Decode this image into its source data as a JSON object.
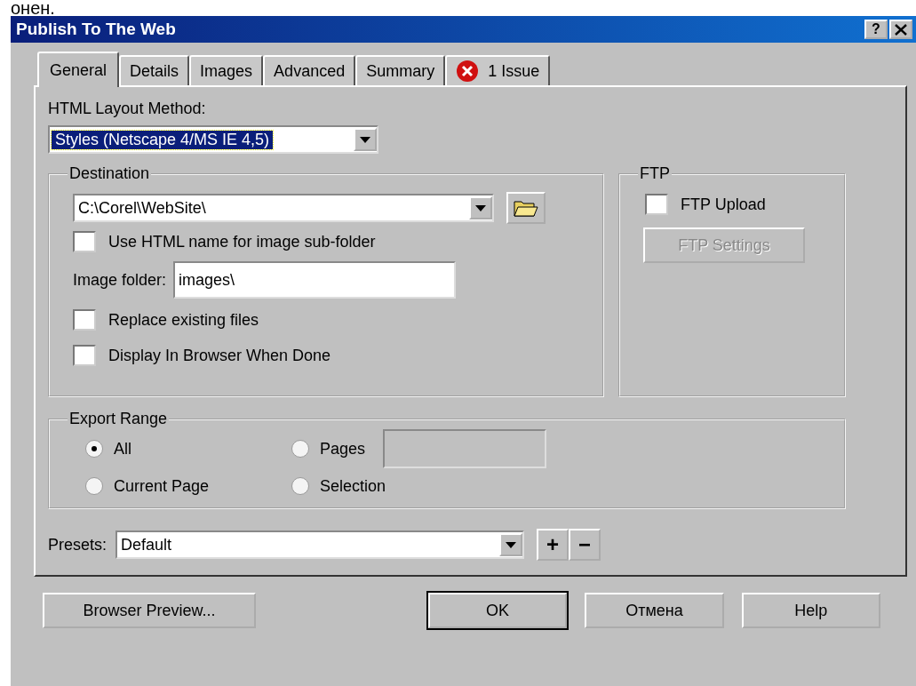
{
  "slide_fragment": "онен.",
  "window": {
    "title": "Publish To The Web",
    "help_button": "?"
  },
  "tabs": [
    {
      "label": "General",
      "selected": true,
      "kind": "plain"
    },
    {
      "label": "Details",
      "selected": false,
      "kind": "plain"
    },
    {
      "label": "Images",
      "selected": false,
      "kind": "plain"
    },
    {
      "label": "Advanced",
      "selected": false,
      "kind": "plain"
    },
    {
      "label": "Summary",
      "selected": false,
      "kind": "plain"
    },
    {
      "label": "1 Issue",
      "selected": false,
      "kind": "issue"
    }
  ],
  "layout_method": {
    "label": "HTML Layout Method:",
    "value": "Styles (Netscape 4/MS IE 4,5)"
  },
  "destination": {
    "title": "Destination",
    "path": "C:\\Corel\\WebSite\\",
    "use_html_name": {
      "label": "Use HTML name for image sub-folder",
      "checked": false
    },
    "image_folder": {
      "label": "Image folder:",
      "value": "images\\"
    },
    "options": [
      {
        "label": "Replace existing files",
        "checked": false
      },
      {
        "label": "Display In Browser When Done",
        "checked": false
      }
    ]
  },
  "ftp": {
    "title": "FTP",
    "upload": {
      "label": "FTP Upload",
      "checked": false
    },
    "settings_button": {
      "label": "FTP Settings",
      "disabled": true
    }
  },
  "export_range": {
    "title": "Export Range",
    "options": [
      {
        "label": "All",
        "selected": true,
        "kind": "plain"
      },
      {
        "label": "Pages",
        "selected": false,
        "kind": "with_field"
      },
      {
        "label": "Current Page",
        "selected": false,
        "kind": "plain"
      },
      {
        "label": "Selection",
        "selected": false,
        "kind": "plain"
      }
    ]
  },
  "presets": {
    "label": "Presets:",
    "value": "Default",
    "buttons": [
      "+",
      "−"
    ]
  },
  "buttons": [
    {
      "label": "Browser Preview...",
      "default": false
    },
    {
      "label": "OK",
      "default": true
    },
    {
      "label": "Отмена",
      "default": false
    },
    {
      "label": "Help",
      "default": false
    }
  ]
}
